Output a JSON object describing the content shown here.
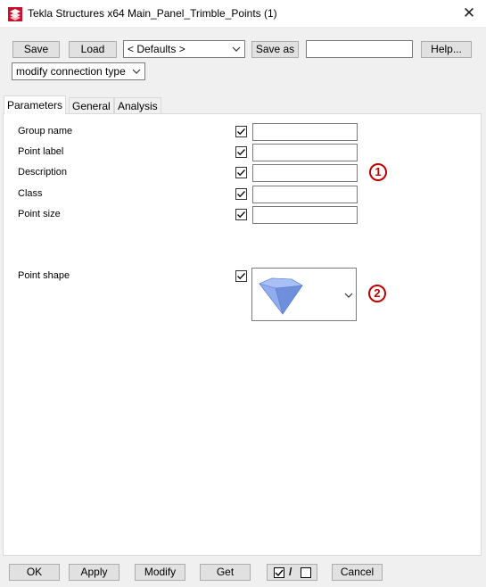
{
  "window": {
    "title": "Tekla Structures x64  Main_Panel_Trimble_Points (1)",
    "close_label": "✕"
  },
  "toolbar": {
    "save_label": "Save",
    "load_label": "Load",
    "defaults_value": "< Defaults >",
    "save_as_label": "Save as",
    "save_as_value": "",
    "help_label": "Help...",
    "mode_value": "modify connection type"
  },
  "tabs": [
    {
      "label": "Parameters",
      "active": true
    },
    {
      "label": "General",
      "active": false
    },
    {
      "label": "Analysis",
      "active": false
    }
  ],
  "parameters": {
    "fields": [
      {
        "label": "Group name",
        "value": "",
        "checked": true
      },
      {
        "label": "Point label",
        "value": "",
        "checked": true
      },
      {
        "label": "Description",
        "value": "",
        "checked": true
      },
      {
        "label": "Class",
        "value": "",
        "checked": true
      },
      {
        "label": "Point size",
        "value": "",
        "checked": true
      }
    ],
    "point_shape": {
      "label": "Point shape",
      "checked": true,
      "icon": "pyramid-shape-icon"
    }
  },
  "markers": [
    "1",
    "2"
  ],
  "bottom": {
    "ok_label": "OK",
    "apply_label": "Apply",
    "modify_label": "Modify",
    "get_label": "Get",
    "slash_label": "/",
    "cancel_label": "Cancel"
  },
  "colors": {
    "marker": "#c00000",
    "shape_fill": "#7f9fe6"
  }
}
